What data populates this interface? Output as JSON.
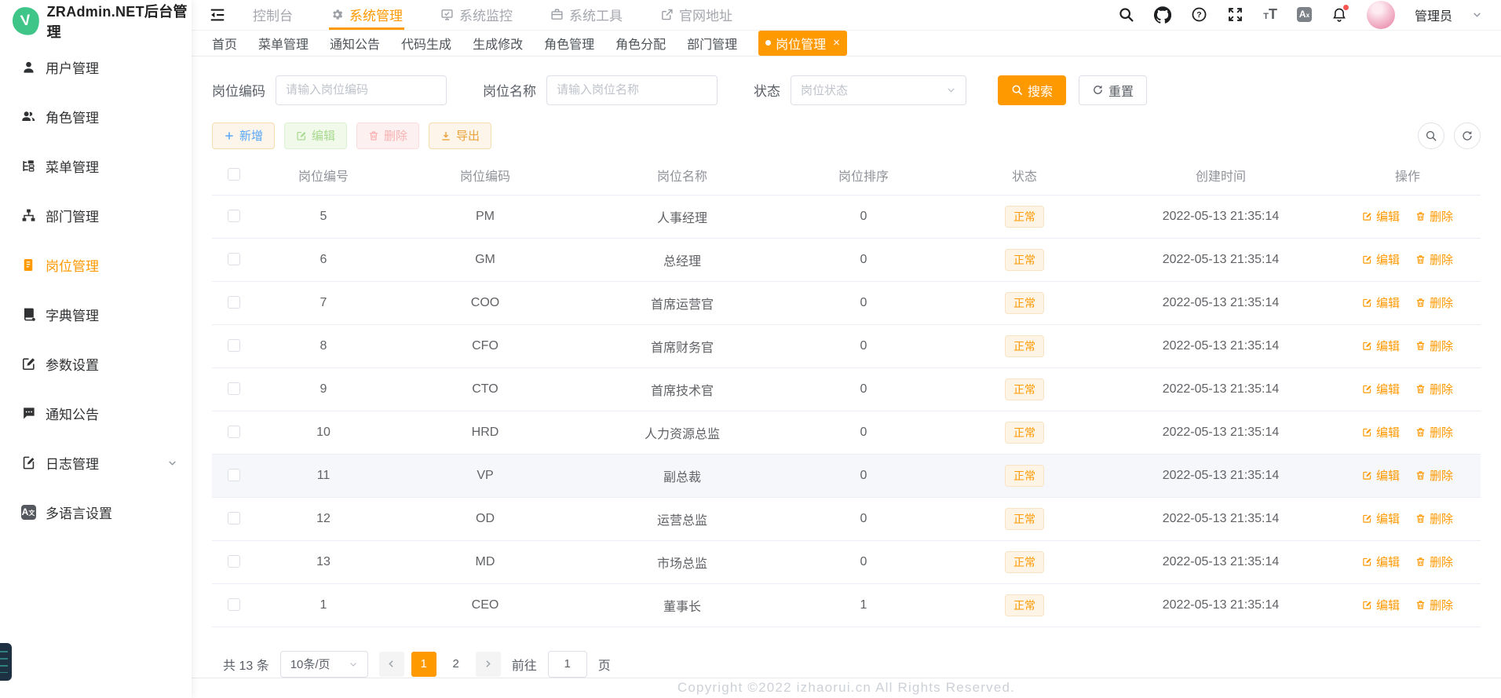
{
  "colors": {
    "primary": "#ff9900",
    "status_tag_text": "#ff9900",
    "status_tag_bg": "#fdf4e6",
    "notification_badge": "#f5574f",
    "logo_green": "#3fc588"
  },
  "app": {
    "title": "ZRAdmin.NET后台管理",
    "logo_letter": "V"
  },
  "topnav": {
    "items": [
      {
        "label": "控制台",
        "icon": null,
        "active": false
      },
      {
        "label": "系统管理",
        "icon": "gear-icon",
        "active": true
      },
      {
        "label": "系统监控",
        "icon": "monitor-icon",
        "active": false
      },
      {
        "label": "系统工具",
        "icon": "toolbox-icon",
        "active": false
      },
      {
        "label": "官网地址",
        "icon": "external-link-icon",
        "active": false
      }
    ]
  },
  "header_actions": {
    "icons": [
      "search-icon",
      "github-icon",
      "help-icon",
      "fullscreen-icon",
      "font-size-icon",
      "language-icon",
      "bell-icon"
    ],
    "bell_has_badge": true,
    "user_name": "管理员"
  },
  "sidebar": {
    "active_index": 4,
    "items": [
      {
        "label": "用户管理",
        "icon": "user-icon"
      },
      {
        "label": "角色管理",
        "icon": "roles-icon"
      },
      {
        "label": "菜单管理",
        "icon": "menu-tree-icon"
      },
      {
        "label": "部门管理",
        "icon": "org-icon"
      },
      {
        "label": "岗位管理",
        "icon": "badge-icon"
      },
      {
        "label": "字典管理",
        "icon": "dictionary-icon"
      },
      {
        "label": "参数设置",
        "icon": "settings-edit-icon"
      },
      {
        "label": "通知公告",
        "icon": "announcement-icon"
      },
      {
        "label": "日志管理",
        "icon": "log-icon",
        "has_children": true
      },
      {
        "label": "多语言设置",
        "icon": "i18n-icon"
      }
    ]
  },
  "tabs": {
    "items": [
      {
        "label": "首页",
        "active": false,
        "closable": false
      },
      {
        "label": "菜单管理",
        "active": false,
        "closable": false
      },
      {
        "label": "通知公告",
        "active": false,
        "closable": false
      },
      {
        "label": "代码生成",
        "active": false,
        "closable": false
      },
      {
        "label": "生成修改",
        "active": false,
        "closable": false
      },
      {
        "label": "角色管理",
        "active": false,
        "closable": false
      },
      {
        "label": "角色分配",
        "active": false,
        "closable": false
      },
      {
        "label": "部门管理",
        "active": false,
        "closable": false
      },
      {
        "label": "岗位管理",
        "active": true,
        "closable": true
      }
    ]
  },
  "filters": {
    "post_code": {
      "label": "岗位编码",
      "placeholder": "请输入岗位编码",
      "value": ""
    },
    "post_name": {
      "label": "岗位名称",
      "placeholder": "请输入岗位名称",
      "value": ""
    },
    "status": {
      "label": "状态",
      "placeholder": "岗位状态"
    },
    "search_label": "搜索",
    "reset_label": "重置"
  },
  "toolbar": {
    "add_label": "新增",
    "edit_label": "编辑",
    "delete_label": "删除",
    "export_label": "导出"
  },
  "table": {
    "headers": [
      "岗位编号",
      "岗位编码",
      "岗位名称",
      "岗位排序",
      "状态",
      "创建时间",
      "操作"
    ],
    "row_actions": {
      "edit": "编辑",
      "delete": "删除"
    },
    "rows": [
      {
        "id": "5",
        "code": "PM",
        "name": "人事经理",
        "sort": "0",
        "status": "正常",
        "created": "2022-05-13 21:35:14",
        "highlighted": false
      },
      {
        "id": "6",
        "code": "GM",
        "name": "总经理",
        "sort": "0",
        "status": "正常",
        "created": "2022-05-13 21:35:14",
        "highlighted": false
      },
      {
        "id": "7",
        "code": "COO",
        "name": "首席运营官",
        "sort": "0",
        "status": "正常",
        "created": "2022-05-13 21:35:14",
        "highlighted": false
      },
      {
        "id": "8",
        "code": "CFO",
        "name": "首席财务官",
        "sort": "0",
        "status": "正常",
        "created": "2022-05-13 21:35:14",
        "highlighted": false
      },
      {
        "id": "9",
        "code": "CTO",
        "name": "首席技术官",
        "sort": "0",
        "status": "正常",
        "created": "2022-05-13 21:35:14",
        "highlighted": false
      },
      {
        "id": "10",
        "code": "HRD",
        "name": "人力资源总监",
        "sort": "0",
        "status": "正常",
        "created": "2022-05-13 21:35:14",
        "highlighted": false
      },
      {
        "id": "11",
        "code": "VP",
        "name": "副总裁",
        "sort": "0",
        "status": "正常",
        "created": "2022-05-13 21:35:14",
        "highlighted": true
      },
      {
        "id": "12",
        "code": "OD",
        "name": "运营总监",
        "sort": "0",
        "status": "正常",
        "created": "2022-05-13 21:35:14",
        "highlighted": false
      },
      {
        "id": "13",
        "code": "MD",
        "name": "市场总监",
        "sort": "0",
        "status": "正常",
        "created": "2022-05-13 21:35:14",
        "highlighted": false
      },
      {
        "id": "1",
        "code": "CEO",
        "name": "董事长",
        "sort": "1",
        "status": "正常",
        "created": "2022-05-13 21:35:14",
        "highlighted": false
      }
    ]
  },
  "pagination": {
    "total": "共 13 条",
    "page_size": "10条/页",
    "pages": [
      {
        "label": "1",
        "active": true
      },
      {
        "label": "2",
        "active": false
      }
    ],
    "goto_label": "前往",
    "goto_value": "1",
    "goto_suffix": "页"
  },
  "footer": {
    "copyright": "Copyright ©2022 izhaorui.cn All Rights Reserved."
  }
}
